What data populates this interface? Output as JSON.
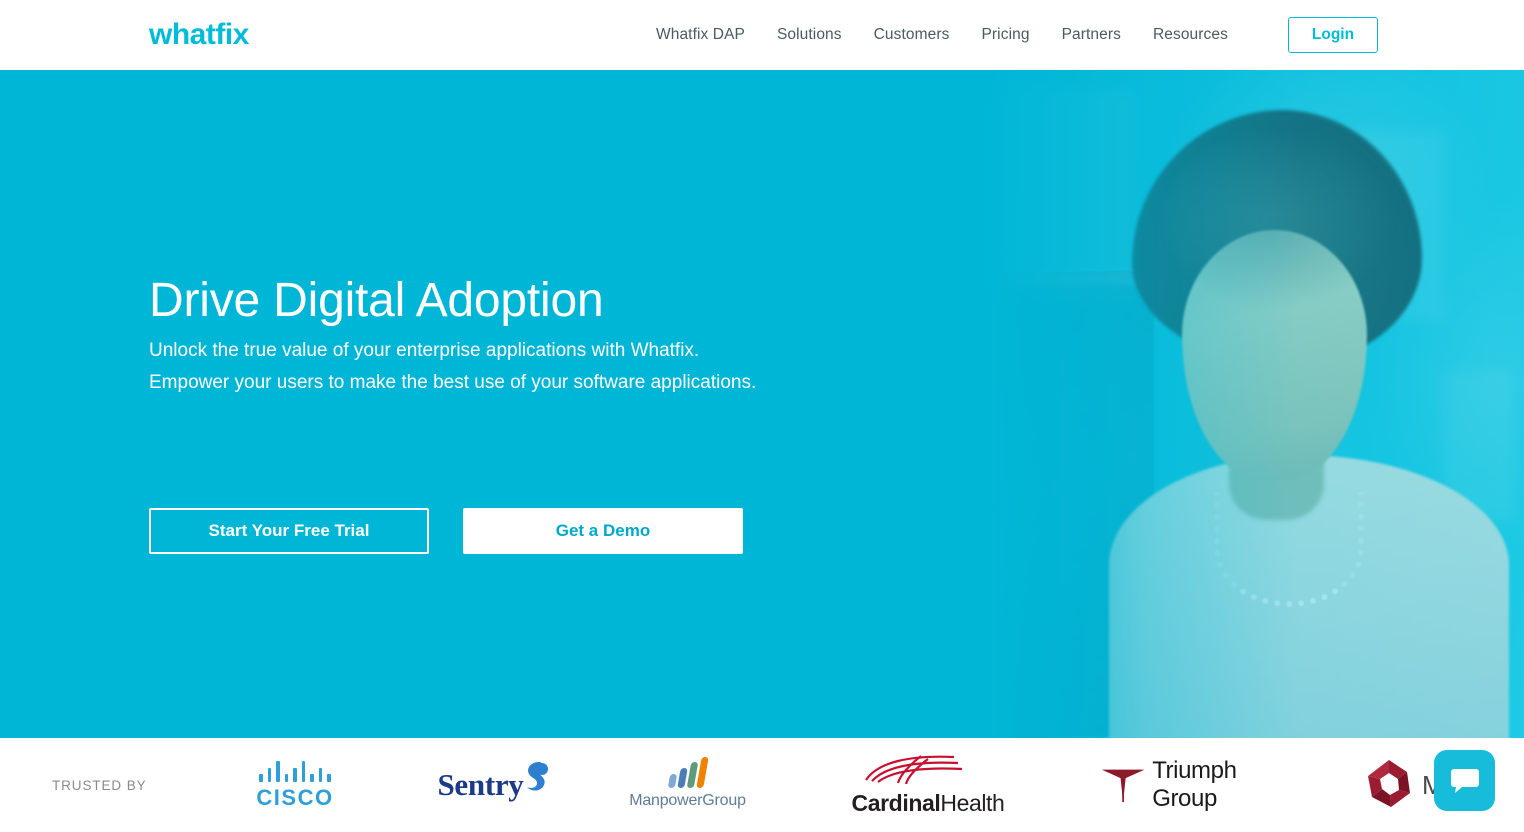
{
  "header": {
    "logo_text": "whatfix",
    "logo_color": "#00bcd9",
    "nav_items": [
      {
        "label": "Whatfix DAP"
      },
      {
        "label": "Solutions"
      },
      {
        "label": "Customers"
      },
      {
        "label": "Pricing"
      },
      {
        "label": "Partners"
      },
      {
        "label": "Resources"
      }
    ],
    "login_label": "Login"
  },
  "hero": {
    "title": "Drive Digital Adoption",
    "subtitle": "Unlock the true value of your enterprise applications with Whatfix. Empower your users to make the best use of your software applications.",
    "primary_cta": "Start Your Free Trial",
    "secondary_cta": "Get a Demo",
    "background_color": "#00b6d6"
  },
  "trusted": {
    "label": "TRUSTED BY",
    "logos": [
      {
        "name": "Cisco",
        "word": "CISCO",
        "color": "#2e9fd8"
      },
      {
        "name": "Sentry",
        "word": "Sentry",
        "color": "#1b3a87"
      },
      {
        "name": "ManpowerGroup",
        "word": "ManpowerGroup",
        "color": "#5f7c97"
      },
      {
        "name": "Cardinal Health",
        "word_bold": "Cardinal",
        "word_light": "Health",
        "color": "#231f20",
        "mark_color": "#c8102e"
      },
      {
        "name": "Triumph Group",
        "word": "Triumph Group",
        "color": "#1a1a1a",
        "mark_color": "#8b1a2b"
      },
      {
        "name": "Partial logo",
        "word": "M",
        "color": "#4a4a4a",
        "mark_color": "#9b1b30"
      }
    ]
  },
  "chat": {
    "icon": "chat-bubble-icon",
    "color": "#17bcdb"
  }
}
